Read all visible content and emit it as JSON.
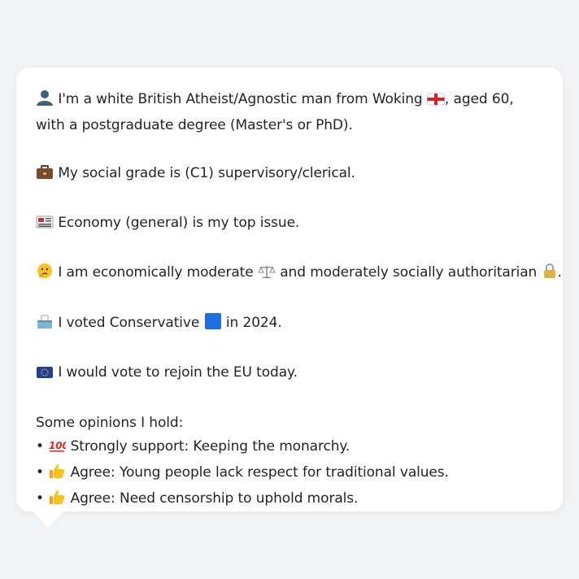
{
  "profile": {
    "intro": {
      "icon": "person-silhouette-icon",
      "text_before": "I'm a white British Atheist/Agnostic man from Woking",
      "flag": "england-flag-icon",
      "text_after": ", aged 60, with a postgraduate degree (Master's or PhD)."
    },
    "social_grade": {
      "icon": "briefcase-icon",
      "text": "My social grade is (C1) supervisory/clerical."
    },
    "top_issue": {
      "icon": "newspaper-icon",
      "text": "Economy (general) is my top issue."
    },
    "ideology": {
      "icon": "thinking-face-icon",
      "text_before": "I am economically moderate",
      "scale_icon": "balance-scale-icon",
      "text_middle": "and moderately socially authoritarian",
      "lock_icon": "lock-icon",
      "text_after": "."
    },
    "vote_2024": {
      "icon": "ballot-box-icon",
      "text_before": "I voted Conservative",
      "party_icon": "blue-square-icon",
      "text_after": "in 2024."
    },
    "eu": {
      "icon": "eu-flag-icon",
      "text": "I would vote to rejoin the EU today."
    },
    "opinions_heading": "Some opinions I hold:",
    "opinions": [
      {
        "bullet": "•",
        "icon": "hundred-points-icon",
        "text": "Strongly support: Keeping the monarchy."
      },
      {
        "bullet": "•",
        "icon": "thumbs-up-icon",
        "text": "Agree: Young people lack respect for traditional values."
      },
      {
        "bullet": "•",
        "icon": "thumbs-up-icon",
        "text": "Agree: Need censorship to uphold morals."
      }
    ]
  },
  "colors": {
    "background": "#f2f3f5",
    "card": "#ffffff",
    "text": "#1f2328",
    "conservative_blue": "#1d6fe3"
  }
}
